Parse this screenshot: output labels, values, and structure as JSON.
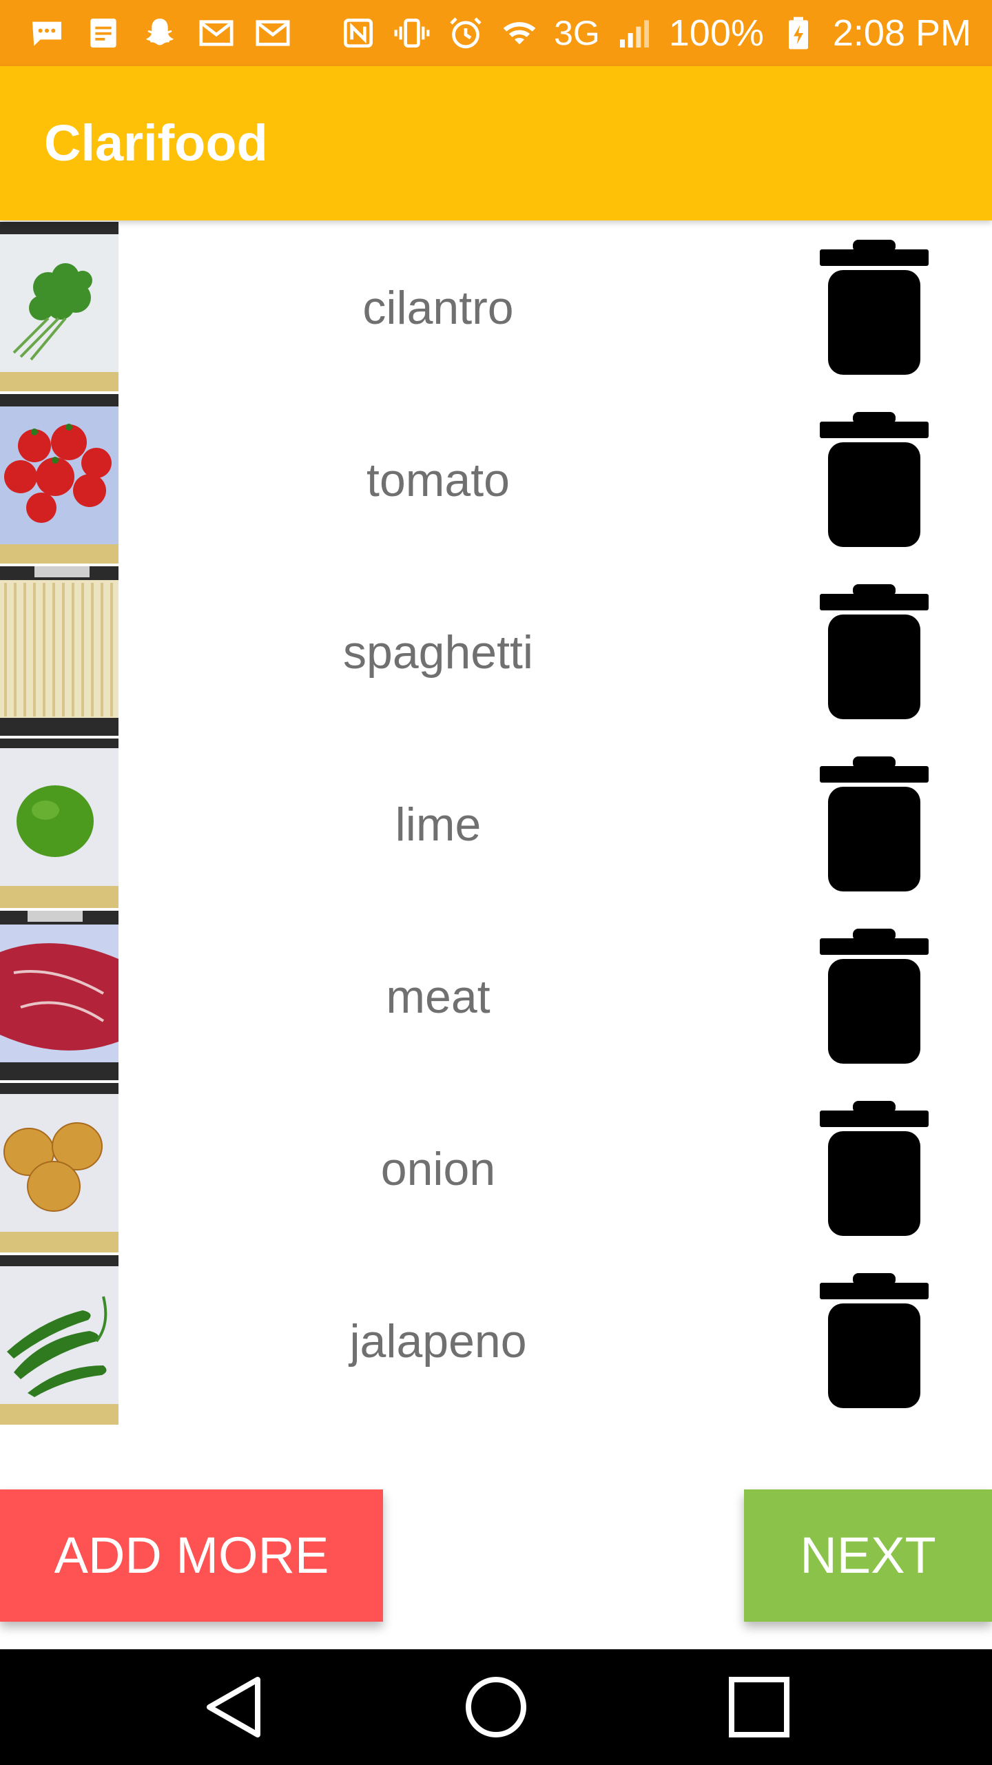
{
  "status_bar": {
    "battery": "100%",
    "time": "2:08 PM",
    "network": "3G",
    "left_icons": [
      "message-icon",
      "notes-icon",
      "snapchat-icon",
      "gmail-icon",
      "gmail-icon"
    ],
    "right_icons": [
      "nfc-icon",
      "vibrate-icon",
      "alarm-icon",
      "wifi-icon",
      "signal-icon",
      "battery-charging-icon"
    ],
    "color": "#F79A10"
  },
  "app_bar": {
    "title": "Clarifood",
    "color": "#FFC107"
  },
  "ingredients": [
    {
      "name": "cilantro",
      "image": "cilantro-photo"
    },
    {
      "name": "tomato",
      "image": "tomato-photo"
    },
    {
      "name": "spaghetti",
      "image": "spaghetti-photo"
    },
    {
      "name": "lime",
      "image": "lime-photo"
    },
    {
      "name": "meat",
      "image": "meat-photo"
    },
    {
      "name": "onion",
      "image": "onion-photo"
    },
    {
      "name": "jalapeno",
      "image": "jalapeno-photo"
    }
  ],
  "row_action_icon": "trash-icon",
  "buttons": {
    "add_more": "ADD MORE",
    "next": "NEXT",
    "add_more_color": "#FF5252",
    "next_color": "#8BC34A"
  },
  "nav_bar": {
    "icons": [
      "back-icon",
      "home-icon",
      "recents-icon"
    ]
  }
}
